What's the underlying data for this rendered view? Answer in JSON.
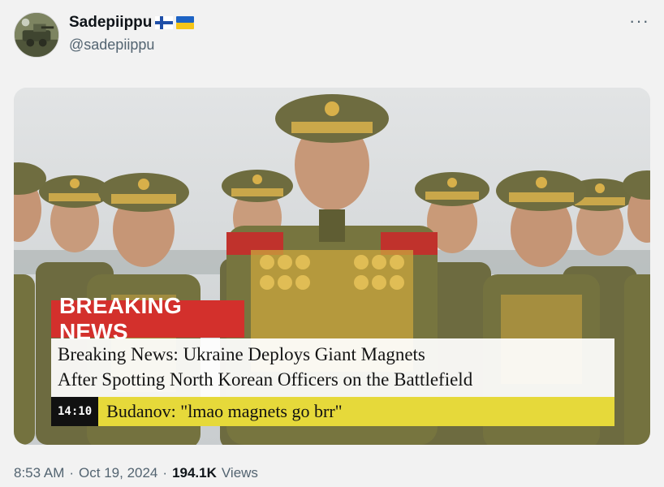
{
  "author": {
    "display_name": "Sadepiippu",
    "handle": "@sadepiippu",
    "flags": [
      "finland-flag",
      "ukraine-flag"
    ]
  },
  "more_icon": "more-options-icon",
  "media": {
    "breaking_label": "BREAKING NEWS",
    "headline_line1": "Breaking News: Ukraine Deploys Giant Magnets",
    "headline_line2": "After Spotting North Korean Officers on the Battlefield",
    "time": "14:10",
    "ticker": "Budanov: \"lmao magnets go brr\"",
    "colors": {
      "breaking_red": "#d3302c",
      "ticker_yellow": "#e6d93a",
      "uniform_green": "#6b6a3e"
    }
  },
  "meta": {
    "time": "8:53 AM",
    "date": "Oct 19, 2024",
    "views_count": "194.1K",
    "views_label": "Views"
  }
}
